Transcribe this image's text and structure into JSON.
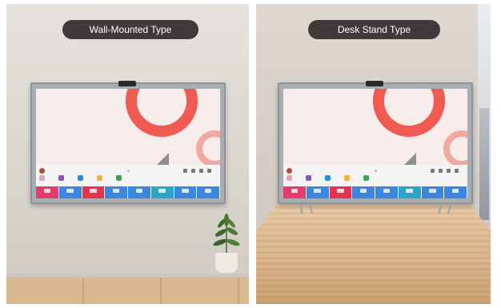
{
  "labels": {
    "wall": "Wall-Mounted Type",
    "desk": "Desk Stand Type"
  },
  "icons": {
    "plant": "potted-plant-icon",
    "camera": "camera-icon"
  },
  "colors": {
    "badge": "#3f3a3a",
    "accent": "#ef5b50",
    "tiles": [
      "#e43d6c",
      "#e43d6c",
      "#3a87e0",
      "#3a87e0",
      "#3a87e0",
      "#e5324f",
      "#3a87e0",
      "#3a87e0",
      "#3a87e0",
      "#28a5c9",
      "#3a87e0",
      "#3a87e0"
    ],
    "apps": [
      "#e4a1b8",
      "#8a50c8",
      "#1d8fe8",
      "#f2b42a",
      "#33a852",
      "#3a87e0",
      "#e43d6c"
    ]
  }
}
